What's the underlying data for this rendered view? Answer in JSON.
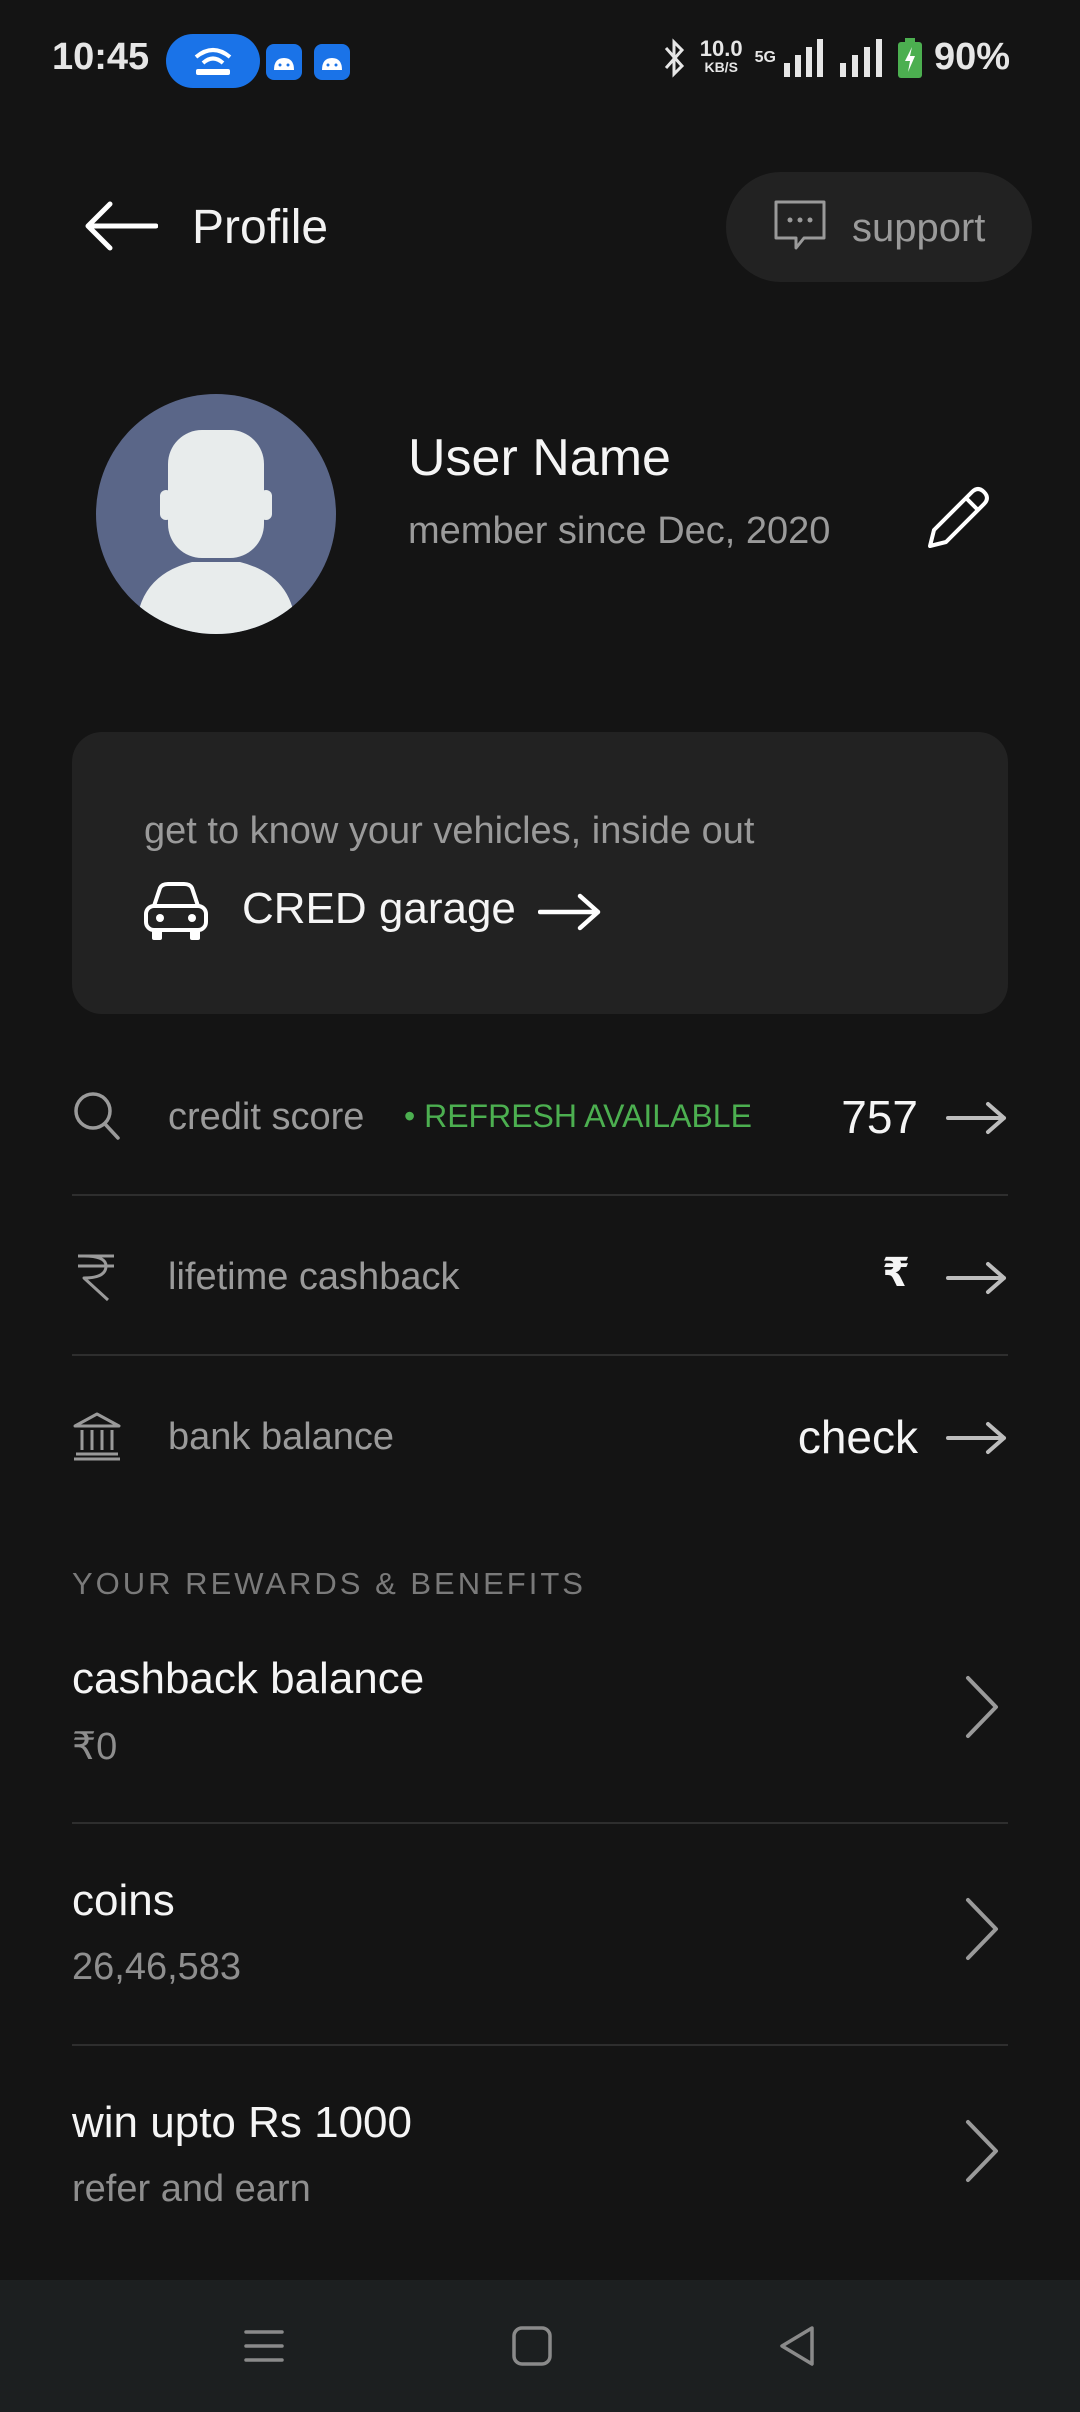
{
  "status_bar": {
    "time": "10:45",
    "speed_value": "10.0",
    "speed_unit": "KB/S",
    "network": "5G",
    "battery": "90%"
  },
  "header": {
    "title": "Profile",
    "support_label": "support"
  },
  "profile": {
    "name": "User Name",
    "member_since": "member since Dec, 2020"
  },
  "garage": {
    "subtitle": "get to know your vehicles, inside out",
    "title": "CRED garage"
  },
  "rows": {
    "credit_score": {
      "label": "credit score",
      "badge": "• REFRESH AVAILABLE",
      "value": "757"
    },
    "lifetime_cashback": {
      "label": "lifetime cashback",
      "value": "₹"
    },
    "bank_balance": {
      "label": "bank balance",
      "value": "check"
    }
  },
  "rewards": {
    "section_title": "YOUR REWARDS & BENEFITS",
    "items": [
      {
        "title": "cashback balance",
        "subtitle": "₹0"
      },
      {
        "title": "coins",
        "subtitle": "26,46,583"
      },
      {
        "title": "win upto Rs 1000",
        "subtitle": "refer and earn"
      }
    ]
  },
  "colors": {
    "background": "#141414",
    "card": "#222222",
    "accent_green": "#4caf50",
    "avatar_bg": "#5a6688"
  },
  "icons": [
    "back-arrow-icon",
    "chat-bubble-icon",
    "pencil-icon",
    "car-icon",
    "search-icon",
    "rupee-icon",
    "bank-icon",
    "arrow-right-icon",
    "chevron-right-icon",
    "menu-icon",
    "home-square-icon",
    "back-triangle-icon"
  ]
}
